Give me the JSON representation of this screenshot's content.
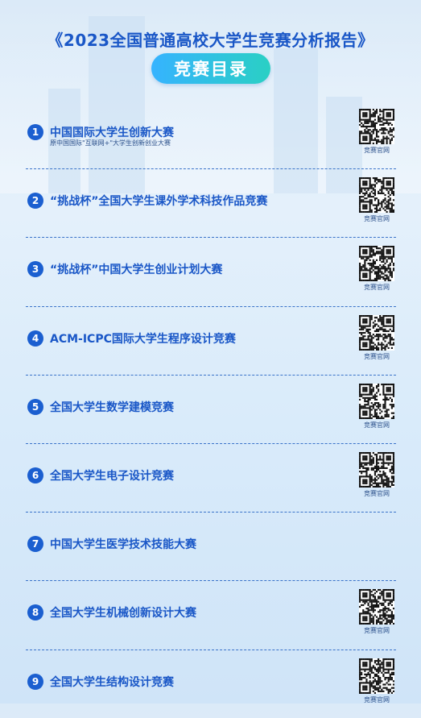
{
  "header": {
    "title": "《2023全国普通高校大学生竞赛分析报告》",
    "badge": "竞赛目录"
  },
  "items": [
    {
      "num": "1",
      "name": "中国国际大学生创新大赛",
      "sub": "原中国国际\"互联网+\"大学生创新创业大赛",
      "has_qr": true,
      "qr_label": "竞赛官网"
    },
    {
      "num": "2",
      "name": "“挑战杯”全国大学生课外学术科技作品竞赛",
      "sub": "",
      "has_qr": true,
      "qr_label": "竞赛官网"
    },
    {
      "num": "3",
      "name": "“挑战杯”中国大学生创业计划大赛",
      "sub": "",
      "has_qr": true,
      "qr_label": "竞赛官网"
    },
    {
      "num": "4",
      "name": "ACM-ICPC国际大学生程序设计竞赛",
      "sub": "",
      "has_qr": true,
      "qr_label": "竞赛官网"
    },
    {
      "num": "5",
      "name": "全国大学生数学建模竞赛",
      "sub": "",
      "has_qr": true,
      "qr_label": "竞赛官网"
    },
    {
      "num": "6",
      "name": "全国大学生电子设计竞赛",
      "sub": "",
      "has_qr": true,
      "qr_label": "竞赛官网"
    },
    {
      "num": "7",
      "name": "中国大学生医学技术技能大赛",
      "sub": "",
      "has_qr": false,
      "qr_label": ""
    },
    {
      "num": "8",
      "name": "全国大学生机械创新设计大赛",
      "sub": "",
      "has_qr": true,
      "qr_label": "竞赛官网"
    },
    {
      "num": "9",
      "name": "全国大学生结构设计竞赛",
      "sub": "",
      "has_qr": true,
      "qr_label": "竞赛官网"
    }
  ],
  "colors": {
    "accent": "#1a57c7",
    "badge_start": "#36b3ff",
    "badge_end": "#2ad0c4"
  }
}
